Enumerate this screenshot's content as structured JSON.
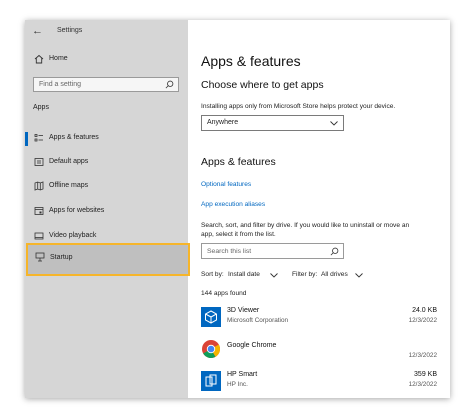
{
  "window": {
    "title": "Settings"
  },
  "sidebar": {
    "home_label": "Home",
    "search_placeholder": "Find a setting",
    "section_label": "Apps",
    "items": [
      {
        "label": "Apps & features",
        "icon": "apps-list-icon"
      },
      {
        "label": "Default apps",
        "icon": "default-apps-icon"
      },
      {
        "label": "Offline maps",
        "icon": "map-icon"
      },
      {
        "label": "Apps for websites",
        "icon": "website-apps-icon"
      },
      {
        "label": "Video playback",
        "icon": "video-icon"
      },
      {
        "label": "Startup",
        "icon": "startup-icon"
      }
    ]
  },
  "main": {
    "title": "Apps & features",
    "choose_heading": "Choose where to get apps",
    "choose_desc": "Installing apps only from Microsoft Store helps protect your device.",
    "source_value": "Anywhere",
    "features_heading": "Apps & features",
    "optional_features": "Optional features",
    "execution_aliases": "App execution aliases",
    "search_desc_1": "Search, sort, and filter by drive. If you would like to uninstall or move an",
    "search_desc_2": "app, select it from the list.",
    "list_search_placeholder": "Search this list",
    "sort_label": "Sort by:",
    "sort_value": "Install date",
    "filter_label": "Filter by:",
    "filter_value": "All drives",
    "apps_count": "144 apps found",
    "apps": [
      {
        "name": "3D Viewer",
        "publisher": "Microsoft Corporation",
        "size": "24.0 KB",
        "date": "12/3/2022"
      },
      {
        "name": "Google Chrome",
        "publisher": "",
        "size": "",
        "date": "12/3/2022"
      },
      {
        "name": "HP Smart",
        "publisher": "HP Inc.",
        "size": "359 KB",
        "date": "12/3/2022"
      }
    ]
  },
  "colors": {
    "accent": "#0067c0",
    "highlight": "#f6b52a",
    "sidebar_bg": "#d6d6d6"
  }
}
